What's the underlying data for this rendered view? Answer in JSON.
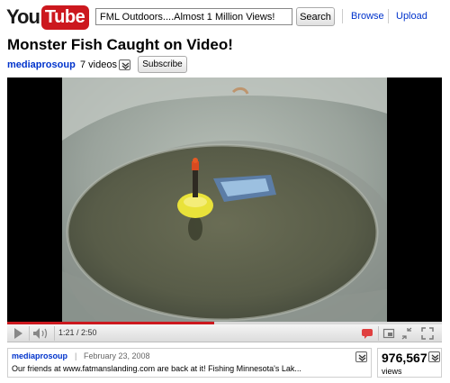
{
  "header": {
    "logo_you": "You",
    "logo_tube": "Tube",
    "search_value": "FML Outdoors....Almost 1 Million Views!",
    "search_button": "Search",
    "browse_label": "Browse",
    "upload_label": "Upload"
  },
  "video": {
    "title": "Monster Fish Caught on Video!",
    "channel": "mediaprosoup",
    "video_count": "7 videos",
    "subscribe_label": "Subscribe"
  },
  "player": {
    "time_display": "1:21 / 2:50",
    "progress_played": 0.476,
    "progress_loaded": 0.476
  },
  "info": {
    "channel": "mediaprosoup",
    "separator": "|",
    "date": "February 23, 2008",
    "description": "Our friends at www.fatmanslanding.com are back at it! Fishing Minnesota's Lak..."
  },
  "stats": {
    "views": "976,567",
    "views_label": "views"
  },
  "icons": {
    "play": "play-icon",
    "volume": "volume-icon",
    "annotations": "annotation-bubble-icon",
    "popout": "popout-icon",
    "size": "size-toggle-icon",
    "fullscreen": "fullscreen-icon",
    "dropdown": "chevron-down-icon"
  },
  "colors": {
    "brand_red": "#cc181e",
    "link_blue": "#0033cc"
  }
}
